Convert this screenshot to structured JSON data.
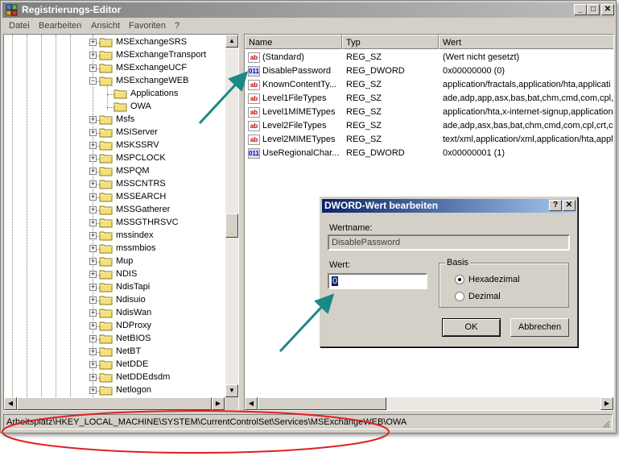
{
  "window": {
    "title": "Registrierungs-Editor",
    "minimize_glyph": "_",
    "maximize_glyph": "□",
    "close_glyph": "✕",
    "icon": "registry-editor-icon"
  },
  "menu": [
    {
      "label": "Datei"
    },
    {
      "label": "Bearbeiten"
    },
    {
      "label": "Ansicht"
    },
    {
      "label": "Favoriten"
    },
    {
      "label": "?"
    }
  ],
  "tree": {
    "items": [
      {
        "label": "MSExchangeSRS",
        "expander": "+"
      },
      {
        "label": "MSExchangeTransport",
        "expander": "+"
      },
      {
        "label": "MSExchangeUCF",
        "expander": "+"
      },
      {
        "label": "MSExchangeWEB",
        "expander": "−"
      },
      {
        "label": "Applications",
        "expander": ""
      },
      {
        "label": "OWA",
        "expander": ""
      },
      {
        "label": "Msfs",
        "expander": "+"
      },
      {
        "label": "MSIServer",
        "expander": "+"
      },
      {
        "label": "MSKSSRV",
        "expander": "+"
      },
      {
        "label": "MSPCLOCK",
        "expander": "+"
      },
      {
        "label": "MSPQM",
        "expander": "+"
      },
      {
        "label": "MSSCNTRS",
        "expander": "+"
      },
      {
        "label": "MSSEARCH",
        "expander": "+"
      },
      {
        "label": "MSSGatherer",
        "expander": "+"
      },
      {
        "label": "MSSGTHRSVC",
        "expander": "+"
      },
      {
        "label": "mssindex",
        "expander": "+"
      },
      {
        "label": "mssmbios",
        "expander": "+"
      },
      {
        "label": "Mup",
        "expander": "+"
      },
      {
        "label": "NDIS",
        "expander": "+"
      },
      {
        "label": "NdisTapi",
        "expander": "+"
      },
      {
        "label": "Ndisuio",
        "expander": "+"
      },
      {
        "label": "NdisWan",
        "expander": "+"
      },
      {
        "label": "NDProxy",
        "expander": "+"
      },
      {
        "label": "NetBIOS",
        "expander": "+"
      },
      {
        "label": "NetBT",
        "expander": "+"
      },
      {
        "label": "NetDDE",
        "expander": "+"
      },
      {
        "label": "NetDDEdsdm",
        "expander": "+"
      },
      {
        "label": "Netlogon",
        "expander": "+"
      }
    ]
  },
  "list": {
    "columns": [
      {
        "label": "Name"
      },
      {
        "label": "Typ"
      },
      {
        "label": "Wert"
      }
    ],
    "rows": [
      {
        "icon": "ab",
        "name": "(Standard)",
        "type": "REG_SZ",
        "value": "(Wert nicht gesetzt)"
      },
      {
        "icon": "dw",
        "name": "DisablePassword",
        "type": "REG_DWORD",
        "value": "0x00000000 (0)"
      },
      {
        "icon": "ab",
        "name": "KnownContentTy...",
        "type": "REG_SZ",
        "value": "application/fractals,application/hta,applicati"
      },
      {
        "icon": "ab",
        "name": "Level1FileTypes",
        "type": "REG_SZ",
        "value": "ade,adp,app,asx,bas,bat,chm,cmd,com,cpl,"
      },
      {
        "icon": "ab",
        "name": "Level1MIMETypes",
        "type": "REG_SZ",
        "value": "application/hta,x-internet-signup,application"
      },
      {
        "icon": "ab",
        "name": "Level2FileTypes",
        "type": "REG_SZ",
        "value": "ade,adp,asx,bas,bat,chm,cmd,com,cpl,crt,c"
      },
      {
        "icon": "ab",
        "name": "Level2MIMETypes",
        "type": "REG_SZ",
        "value": "text/xml,application/xml,application/hta,appl"
      },
      {
        "icon": "dw",
        "name": "UseRegionalChar...",
        "type": "REG_DWORD",
        "value": "0x00000001 (1)"
      }
    ],
    "icon_text": {
      "ab": "ab",
      "dw": "011"
    }
  },
  "statusbar": {
    "path": "Arbeitsplatz\\HKEY_LOCAL_MACHINE\\SYSTEM\\CurrentControlSet\\Services\\MSExchangeWEB\\OWA"
  },
  "dialog": {
    "title": "DWORD-Wert bearbeiten",
    "help_glyph": "?",
    "close_glyph": "✕",
    "name_label": "Wertname:",
    "name_value": "DisablePassword",
    "value_label": "Wert:",
    "value_value": "0",
    "basis_label": "Basis",
    "radio_hex": "Hexadezimal",
    "radio_dec": "Dezimal",
    "selected_basis": "Hexadezimal",
    "ok_label": "OK",
    "cancel_label": "Abbrechen"
  },
  "colors": {
    "annotation_arrow": "#1a8a85",
    "annotation_ellipse": "#e02020",
    "dialog_title_bg": "#0a246a"
  }
}
